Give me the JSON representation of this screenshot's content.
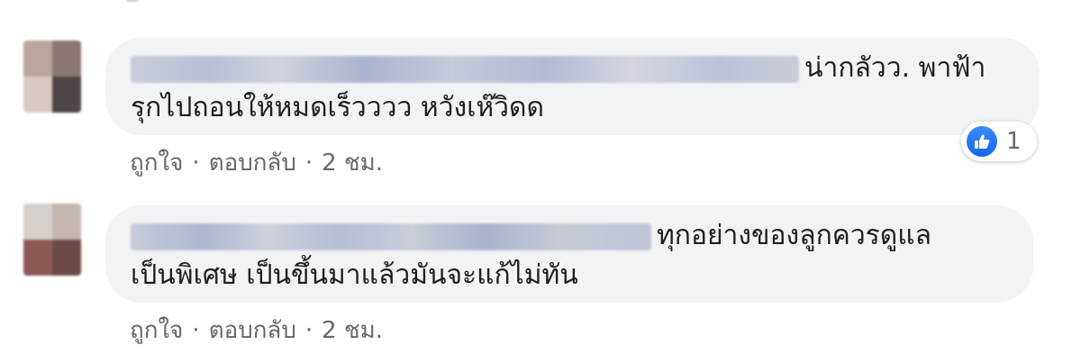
{
  "comments": [
    {
      "text_line1": "น่ากลัวว. พาฟ้า",
      "text_line2": "รุกไปถอนให้หมดเร็วววว หวังเห๊วิดด",
      "like_label": "ถูกใจ",
      "reply_label": "ตอบกลับ",
      "separator": "·",
      "time": "2 ชม.",
      "reaction_count": "1"
    },
    {
      "text_line1": "ทุกอย่างของลูกควรดูแล",
      "text_line2": "เป็นพิเศษ เป็นขึ้นมาแล้วมันจะแก้ไม่ทัน",
      "like_label": "ถูกใจ",
      "reply_label": "ตอบกลับ",
      "separator": "·",
      "time": "2 ชม."
    }
  ],
  "colors": {
    "bubble": "#f2f3f5",
    "meta_text": "#65676b",
    "like_blue": "#1877f2"
  },
  "icons": {
    "reaction": "like-thumbs-up-icon"
  }
}
